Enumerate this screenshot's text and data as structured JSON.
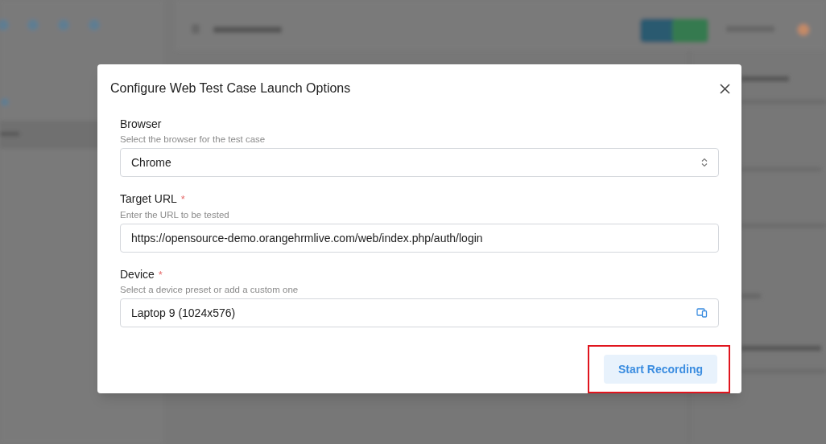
{
  "dialog": {
    "title": "Configure Web Test Case Launch Options",
    "fields": [
      {
        "kind": "select",
        "label": "Browser",
        "required": false,
        "hint": "Select the browser for the test case",
        "value": "Chrome"
      },
      {
        "kind": "text",
        "label": "Target URL",
        "required": true,
        "hint": "Enter the URL to be tested",
        "value": "https://opensource-demo.orangehrmlive.com/web/index.php/auth/login"
      },
      {
        "kind": "device",
        "label": "Device",
        "required": true,
        "hint": "Select a device preset or add a custom one",
        "value": "Laptop 9 (1024x576)"
      }
    ],
    "required_mark": "*",
    "primary_button": {
      "label": "Start Recording",
      "highlighted": true
    }
  }
}
